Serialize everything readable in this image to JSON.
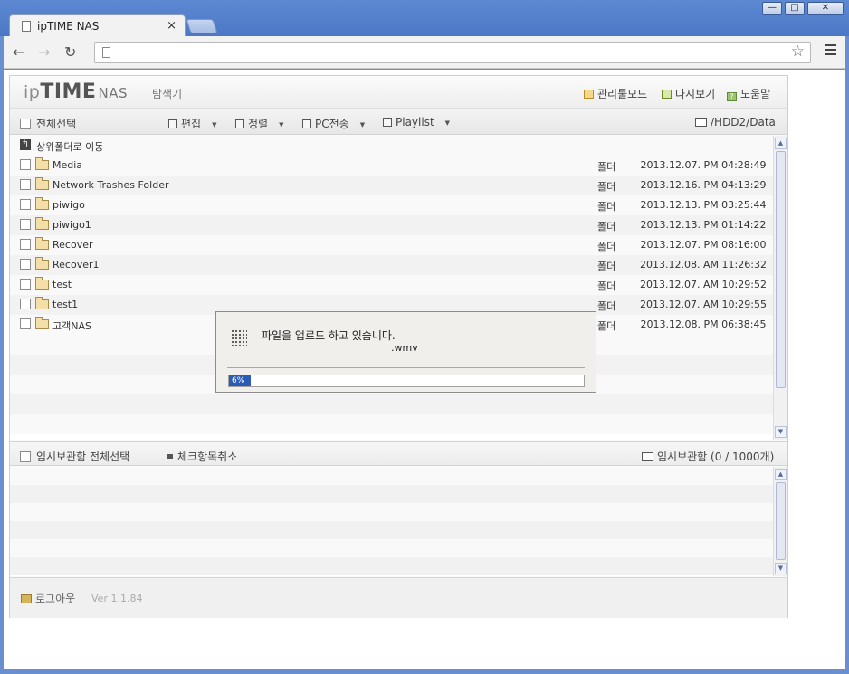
{
  "browser": {
    "tab_title": "ipTIME NAS",
    "tab_close": "×",
    "win_min": "—",
    "win_max": "□",
    "win_close": "✕",
    "nav_back": "←",
    "nav_forward": "→",
    "nav_reload": "↻",
    "bookmark_star": "☆"
  },
  "app": {
    "logo_prefix": "ip",
    "logo_brand": "TIME",
    "logo_suffix": "NAS",
    "section": "탐색기",
    "header_links": [
      "관리툴모드",
      "다시보기",
      "도움말"
    ],
    "help_glyph": "?",
    "toolbar": {
      "select_all": "전체선택",
      "edit": "편집",
      "sort": "정렬",
      "pc_transfer": "PC전송",
      "playlist": "Playlist",
      "path": "/HDD2/Data"
    },
    "up_row": "상위폴더로 이동",
    "files": [
      {
        "name": "Media",
        "kind": "폴더",
        "date": "2013.12.07. PM 04:28:49"
      },
      {
        "name": "Network Trashes Folder",
        "kind": "폴더",
        "date": "2013.12.16. PM 04:13:29"
      },
      {
        "name": "piwigo",
        "kind": "폴더",
        "date": "2013.12.13. PM 03:25:44"
      },
      {
        "name": "piwigo1",
        "kind": "폴더",
        "date": "2013.12.13. PM 01:14:22"
      },
      {
        "name": "Recover",
        "kind": "폴더",
        "date": "2013.12.07. PM 08:16:00"
      },
      {
        "name": "Recover1",
        "kind": "폴더",
        "date": "2013.12.08. AM 11:26:32"
      },
      {
        "name": "test",
        "kind": "폴더",
        "date": "2013.12.07. AM 10:29:52"
      },
      {
        "name": "test1",
        "kind": "폴더",
        "date": "2013.12.07. AM 10:29:55"
      },
      {
        "name": "고객NAS",
        "kind": "폴더",
        "date": "2013.12.08. PM 06:38:45"
      }
    ],
    "temp": {
      "select_all": "임시보관함 전체선택",
      "uncheck": "체크항목취소",
      "count_label": "임시보관함 (0 / 1000개)"
    },
    "footer": {
      "logout": "로그아웃",
      "version": "Ver 1.1.84"
    }
  },
  "upload_dialog": {
    "message": "파일을 업로드 하고 있습니다.",
    "file": ".wmv",
    "progress_percent": 6,
    "progress_label": "6%"
  },
  "colors": {
    "progress": "#2a5bb5",
    "folder": "#f3dfa7",
    "header_icon": "#f4d98a"
  }
}
